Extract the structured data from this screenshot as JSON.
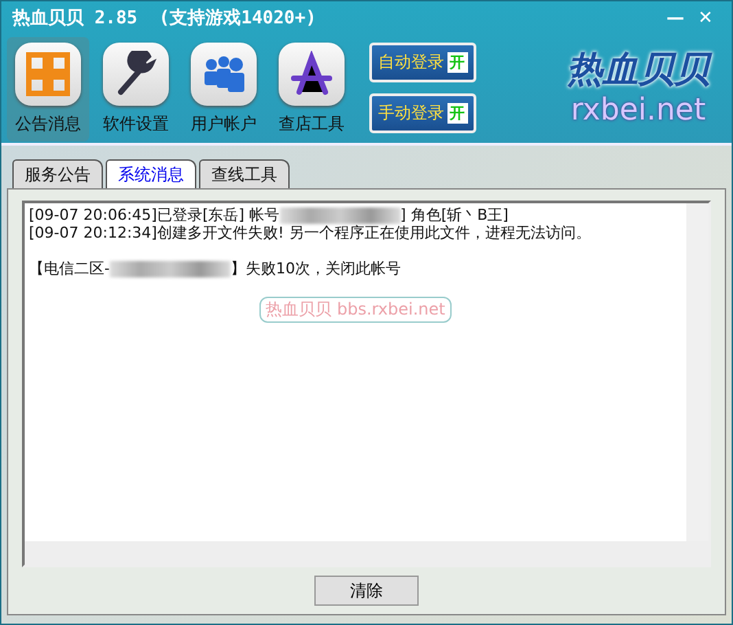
{
  "window": {
    "title": "热血贝贝 2.85  (支持游戏14020+)",
    "controls": [
      "—",
      "✕"
    ]
  },
  "toolbar": [
    {
      "label": "公告消息",
      "selected": true
    },
    {
      "label": "软件设置",
      "selected": false
    },
    {
      "label": "用户帐户",
      "selected": false
    },
    {
      "label": "查店工具",
      "selected": false
    }
  ],
  "toggles": [
    {
      "label": "自动登录",
      "state": "开",
      "on": true
    },
    {
      "label": "手动登录",
      "state": "开",
      "on": true
    }
  ],
  "logo": {
    "title": "热血贝贝",
    "site": "rxbei.net"
  },
  "tabs": [
    {
      "label": "服务公告",
      "selected": false
    },
    {
      "label": "系统消息",
      "selected": true
    },
    {
      "label": "查线工具",
      "selected": false
    }
  ],
  "log": [
    {
      "gap_before": false,
      "segments": [
        {
          "kind": "text",
          "text": "[09-07 20:06:45]已登录[东岳] 帐号"
        },
        {
          "kind": "redacted"
        },
        {
          "kind": "text",
          "text": "] 角色[斩丶B王]"
        }
      ]
    },
    {
      "gap_before": false,
      "segments": [
        {
          "kind": "text",
          "text": "[09-07 20:12:34]创建多开文件失败! 另一个程序正在使用此文件，进程无法访问。"
        }
      ]
    },
    {
      "gap_before": true,
      "segments": [
        {
          "kind": "text",
          "text": "【电信二区-"
        },
        {
          "kind": "redacted"
        },
        {
          "kind": "text",
          "text": "】失败10次，关闭此帐号"
        }
      ]
    }
  ],
  "banner": "热血贝贝 bbs.rxbei.net",
  "buttons": [
    "清除"
  ]
}
